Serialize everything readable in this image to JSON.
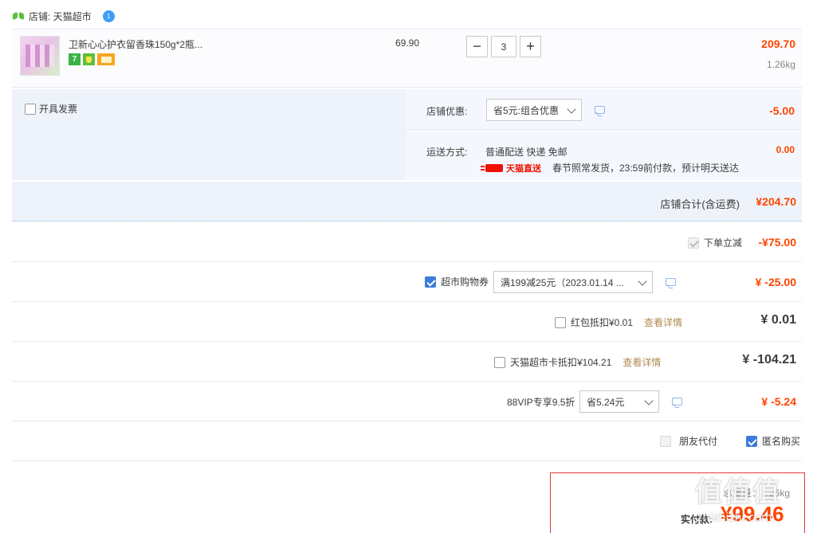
{
  "shop": {
    "label": "店铺: 天猫超市",
    "ww_badge": "1"
  },
  "item": {
    "title": "卫新心心护衣留香珠150g*2瓶...",
    "badge_7": "7",
    "unit_price": "69.90",
    "qty_minus": "−",
    "qty": "3",
    "qty_plus": "+",
    "total": "209.70",
    "weight": "1.26kg"
  },
  "options": {
    "invoice_label": "开具发票",
    "shop_discount_label": "店铺优惠:",
    "shop_discount_select": "省5元:组合优惠",
    "shop_discount_value": "-5.00",
    "shipping_label": "运送方式:",
    "shipping_type": "普通配送 快递 免邮",
    "shipping_value": "0.00",
    "tmall_direct": "天猫直送",
    "shipping_note": "春节照常发货，23:59前付款，预计明天送达"
  },
  "subtotal": {
    "label": "店铺合计(含运费)",
    "value": "¥204.70"
  },
  "rows": {
    "instant_discount_label": "下单立减",
    "instant_discount_value": "-¥75.00",
    "coupon_label": "超市购物券",
    "coupon_select": "满199减25元（2023.01.14 ...",
    "coupon_value": "¥ -25.00",
    "redpacket_label": "红包抵扣¥0.01",
    "redpacket_link": "查看详情",
    "redpacket_value": "¥ 0.01",
    "card_label": "天猫超市卡抵扣¥104.21",
    "card_link": "查看详情",
    "card_value": "¥ -104.21",
    "vip_label": "88VIP专享9.5折",
    "vip_select": "省5.24元",
    "vip_value": "¥ -5.24",
    "friend_pay_label": "朋友代付",
    "anonymous_label": "匿名购买"
  },
  "pay": {
    "weight_label": "总重量：1.26kg",
    "label": "实付款:",
    "amount": "¥99.46"
  },
  "watermark": {
    "logo": "值值值",
    "url": "zhizhizhi.com"
  },
  "colors": {
    "price_red": "#ff4400",
    "accent_blue": "#3c7bd9",
    "panel_bg": "#eef3fb",
    "link_gold": "#b08a4f"
  }
}
